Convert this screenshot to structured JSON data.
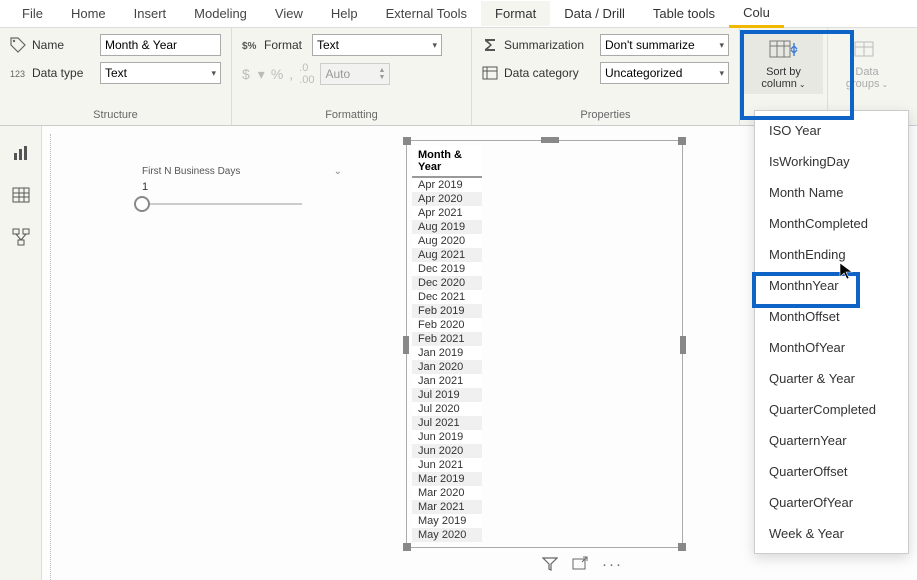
{
  "tabs": [
    "File",
    "Home",
    "Insert",
    "Modeling",
    "View",
    "Help",
    "External Tools",
    "Format",
    "Data / Drill",
    "Table tools",
    "Colu"
  ],
  "activeTabIndex": 7,
  "structure": {
    "name_label": "Name",
    "name_value": "Month & Year",
    "datatype_label": "Data type",
    "datatype_value": "Text",
    "group_title": "Structure"
  },
  "formatting": {
    "format_label": "Format",
    "format_value": "Text",
    "auto_label": "Auto",
    "group_title": "Formatting"
  },
  "properties": {
    "summarization_label": "Summarization",
    "summarization_value": "Don't summarize",
    "category_label": "Data category",
    "category_value": "Uncategorized",
    "group_title": "Properties"
  },
  "sort_button": {
    "label1": "Sort by",
    "label2": "column"
  },
  "groups_button": {
    "label1": "Data",
    "label2": "groups"
  },
  "slicer": {
    "title": "First N Business Days",
    "value": "1"
  },
  "table": {
    "header": "Month & Year",
    "rows": [
      "Apr 2019",
      "Apr 2020",
      "Apr 2021",
      "Aug 2019",
      "Aug 2020",
      "Aug 2021",
      "Dec 2019",
      "Dec 2020",
      "Dec 2021",
      "Feb 2019",
      "Feb 2020",
      "Feb 2021",
      "Jan 2019",
      "Jan 2020",
      "Jan 2021",
      "Jul 2019",
      "Jul 2020",
      "Jul 2021",
      "Jun 2019",
      "Jun 2020",
      "Jun 2021",
      "Mar 2019",
      "Mar 2020",
      "Mar 2021",
      "May 2019",
      "May 2020"
    ]
  },
  "sort_menu": {
    "items": [
      "ISO Year",
      "IsWorkingDay",
      "Month Name",
      "MonthCompleted",
      "MonthEnding",
      "MonthnYear",
      "MonthOffset",
      "MonthOfYear",
      "Quarter & Year",
      "QuarterCompleted",
      "QuarternYear",
      "QuarterOffset",
      "QuarterOfYear",
      "Week & Year"
    ]
  }
}
